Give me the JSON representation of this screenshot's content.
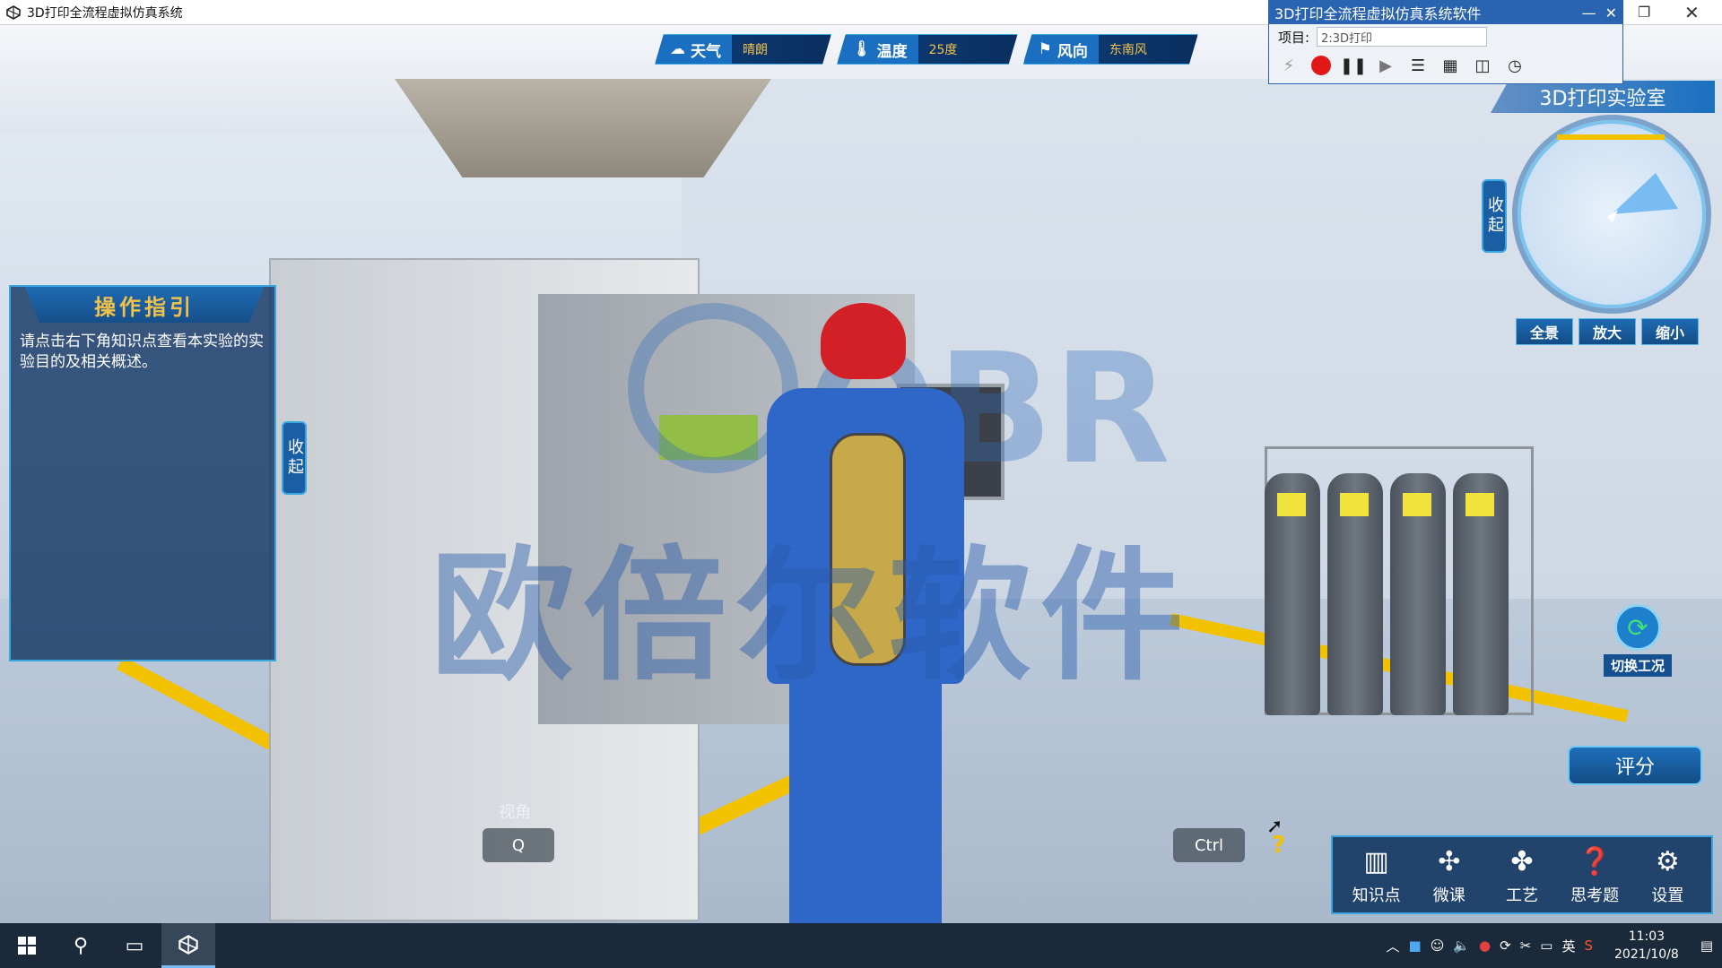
{
  "window": {
    "title": "3D打印全流程虚拟仿真系统",
    "icons": [
      "unity-icon",
      "restore-icon",
      "close-icon"
    ]
  },
  "hud": {
    "weather": {
      "label": "天气",
      "value": "晴朗"
    },
    "temperature": {
      "label": "温度",
      "value": "25度"
    },
    "wind": {
      "label": "风向",
      "value": "东南风"
    }
  },
  "control_window": {
    "title": "3D打印全流程虚拟仿真系统软件",
    "project_label": "项目:",
    "project_value": "2:3D打印",
    "tools": [
      "record-icon",
      "pause-icon",
      "play-icon",
      "list-icon",
      "chart-icon",
      "camera-icon",
      "clock-icon"
    ]
  },
  "guide": {
    "title": "操作指引",
    "text": "请点击右下角知识点查看本实验的实验目的及相关概述。",
    "collapse_label": "收起"
  },
  "minimap": {
    "title": "3D打印实验室",
    "collapse_label": "收起",
    "buttons": [
      "全景",
      "放大",
      "缩小"
    ]
  },
  "scene": {
    "watermark": "欧倍尔软件",
    "watermark_logo": "OBR"
  },
  "switch_mode": {
    "label": "切换工况"
  },
  "score": {
    "label": "评分"
  },
  "toolbar": [
    {
      "label": "知识点",
      "icon": "book-icon"
    },
    {
      "label": "微课",
      "icon": "fan-icon"
    },
    {
      "label": "工艺",
      "icon": "process-icon"
    },
    {
      "label": "思考题",
      "icon": "question-icon"
    },
    {
      "label": "设置",
      "icon": "gear-icon"
    }
  ],
  "key_hints": {
    "view_label": "视角",
    "view_key": "Q",
    "ctrl_key": "Ctrl"
  },
  "taskbar": {
    "ime": "英",
    "time": "11:03",
    "date": "2021/10/8"
  }
}
